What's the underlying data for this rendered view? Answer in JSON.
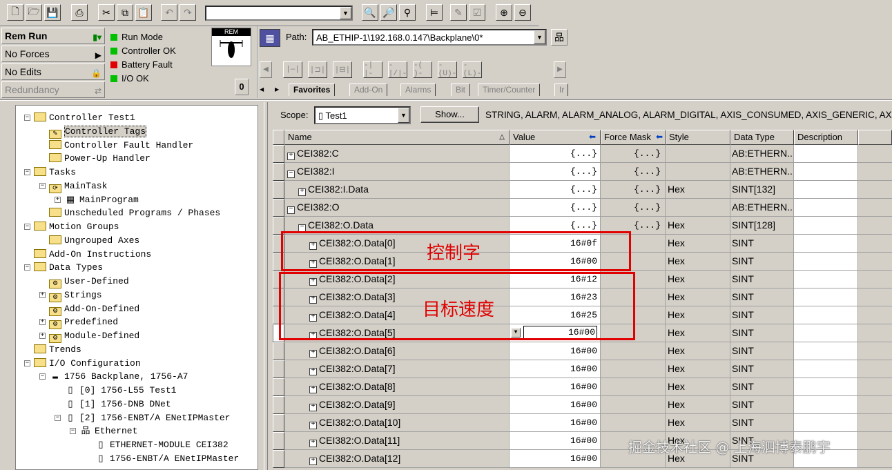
{
  "toolbar": {
    "combo_value": ""
  },
  "status": {
    "mode": "Rem Run",
    "forces": "No Forces",
    "edits": "No Edits",
    "redundancy": "Redundancy",
    "indicators": [
      {
        "label": "Run Mode",
        "color": "#00c000"
      },
      {
        "label": "Controller OK",
        "color": "#00c000"
      },
      {
        "label": "Battery Fault",
        "color": "#e00000"
      },
      {
        "label": "I/O OK",
        "color": "#00c000"
      }
    ],
    "keyswitch_label": "REM"
  },
  "path": {
    "label": "Path:",
    "value": "AB_ETHIP-1\\192.168.0.147\\Backplane\\0*"
  },
  "ladder_tabs": [
    "Favorites",
    "Add-On",
    "Alarms",
    "Bit",
    "Timer/Counter",
    "Ir"
  ],
  "tree": [
    {
      "text": "Controller Test1",
      "depth": 0,
      "exp": "-",
      "kind": "folder"
    },
    {
      "text": "Controller Tags",
      "depth": 1,
      "exp": "",
      "kind": "tags",
      "selected": true
    },
    {
      "text": "Controller Fault Handler",
      "depth": 1,
      "exp": "",
      "kind": "folder"
    },
    {
      "text": "Power-Up Handler",
      "depth": 1,
      "exp": "",
      "kind": "folder"
    },
    {
      "text": "Tasks",
      "depth": 0,
      "exp": "-",
      "kind": "folder"
    },
    {
      "text": "MainTask",
      "depth": 1,
      "exp": "-",
      "kind": "task"
    },
    {
      "text": "MainProgram",
      "depth": 2,
      "exp": "+",
      "kind": "program"
    },
    {
      "text": "Unscheduled Programs / Phases",
      "depth": 1,
      "exp": "",
      "kind": "folder"
    },
    {
      "text": "Motion Groups",
      "depth": 0,
      "exp": "-",
      "kind": "folder"
    },
    {
      "text": "Ungrouped Axes",
      "depth": 1,
      "exp": "",
      "kind": "folder"
    },
    {
      "text": "Add-On Instructions",
      "depth": 0,
      "exp": "",
      "kind": "folder"
    },
    {
      "text": "Data Types",
      "depth": 0,
      "exp": "-",
      "kind": "folder"
    },
    {
      "text": "User-Defined",
      "depth": 1,
      "exp": "",
      "kind": "dtfolder"
    },
    {
      "text": "Strings",
      "depth": 1,
      "exp": "+",
      "kind": "dtfolder"
    },
    {
      "text": "Add-On-Defined",
      "depth": 1,
      "exp": "",
      "kind": "dtfolder"
    },
    {
      "text": "Predefined",
      "depth": 1,
      "exp": "+",
      "kind": "dtfolder"
    },
    {
      "text": "Module-Defined",
      "depth": 1,
      "exp": "+",
      "kind": "dtfolder"
    },
    {
      "text": "Trends",
      "depth": 0,
      "exp": "",
      "kind": "folder"
    },
    {
      "text": "I/O Configuration",
      "depth": 0,
      "exp": "-",
      "kind": "folder"
    },
    {
      "text": "1756 Backplane, 1756-A7",
      "depth": 1,
      "exp": "-",
      "kind": "backplane"
    },
    {
      "text": "[0] 1756-L55 Test1",
      "depth": 2,
      "exp": "",
      "kind": "module"
    },
    {
      "text": "[1] 1756-DNB DNet",
      "depth": 2,
      "exp": "",
      "kind": "module"
    },
    {
      "text": "[2] 1756-ENBT/A ENetIPMaster",
      "depth": 2,
      "exp": "-",
      "kind": "module"
    },
    {
      "text": "Ethernet",
      "depth": 3,
      "exp": "-",
      "kind": "network"
    },
    {
      "text": "ETHERNET-MODULE CEI382",
      "depth": 4,
      "exp": "",
      "kind": "module"
    },
    {
      "text": "1756-ENBT/A ENetIPMaster",
      "depth": 4,
      "exp": "",
      "kind": "module"
    }
  ],
  "scope": {
    "label": "Scope:",
    "value": "Test1",
    "show_button": "Show...",
    "show_types": "STRING, ALARM, ALARM_ANALOG, ALARM_DIGITAL, AXIS_CONSUMED, AXIS_GENERIC, AXIS_G"
  },
  "columns": [
    "Name",
    "Value",
    "Force Mask",
    "Style",
    "Data Type",
    "Description"
  ],
  "rows": [
    {
      "indent": 0,
      "exp": "+",
      "name": "CEI382:C",
      "value": "{...}",
      "force": "{...}",
      "style": "",
      "dtype": "AB:ETHERN..."
    },
    {
      "indent": 0,
      "exp": "-",
      "name": "CEI382:I",
      "value": "{...}",
      "force": "{...}",
      "style": "",
      "dtype": "AB:ETHERN..."
    },
    {
      "indent": 1,
      "exp": "+",
      "name": "CEI382:I.Data",
      "value": "{...}",
      "force": "{...}",
      "style": "Hex",
      "dtype": "SINT[132]"
    },
    {
      "indent": 0,
      "exp": "-",
      "name": "CEI382:O",
      "value": "{...}",
      "force": "{...}",
      "style": "",
      "dtype": "AB:ETHERN..."
    },
    {
      "indent": 1,
      "exp": "-",
      "name": "CEI382:O.Data",
      "value": "{...}",
      "force": "{...}",
      "style": "Hex",
      "dtype": "SINT[128]"
    },
    {
      "indent": 2,
      "exp": "+",
      "name": "CEI382:O.Data[0]",
      "value": "16#0f",
      "force": "",
      "style": "Hex",
      "dtype": "SINT"
    },
    {
      "indent": 2,
      "exp": "+",
      "name": "CEI382:O.Data[1]",
      "value": "16#00",
      "force": "",
      "style": "Hex",
      "dtype": "SINT"
    },
    {
      "indent": 2,
      "exp": "+",
      "name": "CEI382:O.Data[2]",
      "value": "16#12",
      "force": "",
      "style": "Hex",
      "dtype": "SINT"
    },
    {
      "indent": 2,
      "exp": "+",
      "name": "CEI382:O.Data[3]",
      "value": "16#23",
      "force": "",
      "style": "Hex",
      "dtype": "SINT"
    },
    {
      "indent": 2,
      "exp": "+",
      "name": "CEI382:O.Data[4]",
      "value": "16#25",
      "force": "",
      "style": "Hex",
      "dtype": "SINT"
    },
    {
      "indent": 2,
      "exp": "+",
      "name": "CEI382:O.Data[5]",
      "value": "16#00",
      "force": "",
      "style": "Hex",
      "dtype": "SINT",
      "editing": true
    },
    {
      "indent": 2,
      "exp": "+",
      "name": "CEI382:O.Data[6]",
      "value": "16#00",
      "force": "",
      "style": "Hex",
      "dtype": "SINT"
    },
    {
      "indent": 2,
      "exp": "+",
      "name": "CEI382:O.Data[7]",
      "value": "16#00",
      "force": "",
      "style": "Hex",
      "dtype": "SINT"
    },
    {
      "indent": 2,
      "exp": "+",
      "name": "CEI382:O.Data[8]",
      "value": "16#00",
      "force": "",
      "style": "Hex",
      "dtype": "SINT"
    },
    {
      "indent": 2,
      "exp": "+",
      "name": "CEI382:O.Data[9]",
      "value": "16#00",
      "force": "",
      "style": "Hex",
      "dtype": "SINT"
    },
    {
      "indent": 2,
      "exp": "+",
      "name": "CEI382:O.Data[10]",
      "value": "16#00",
      "force": "",
      "style": "Hex",
      "dtype": "SINT"
    },
    {
      "indent": 2,
      "exp": "+",
      "name": "CEI382:O.Data[11]",
      "value": "16#00",
      "force": "",
      "style": "Hex",
      "dtype": "SINT"
    },
    {
      "indent": 2,
      "exp": "+",
      "name": "CEI382:O.Data[12]",
      "value": "16#00",
      "force": "",
      "style": "Hex",
      "dtype": "SINT"
    }
  ],
  "annotations": {
    "box1_label": "控制字",
    "box2_label": "目标速度"
  },
  "watermark": "掘金技术社区 @ 上海泗博泰鹏宇"
}
